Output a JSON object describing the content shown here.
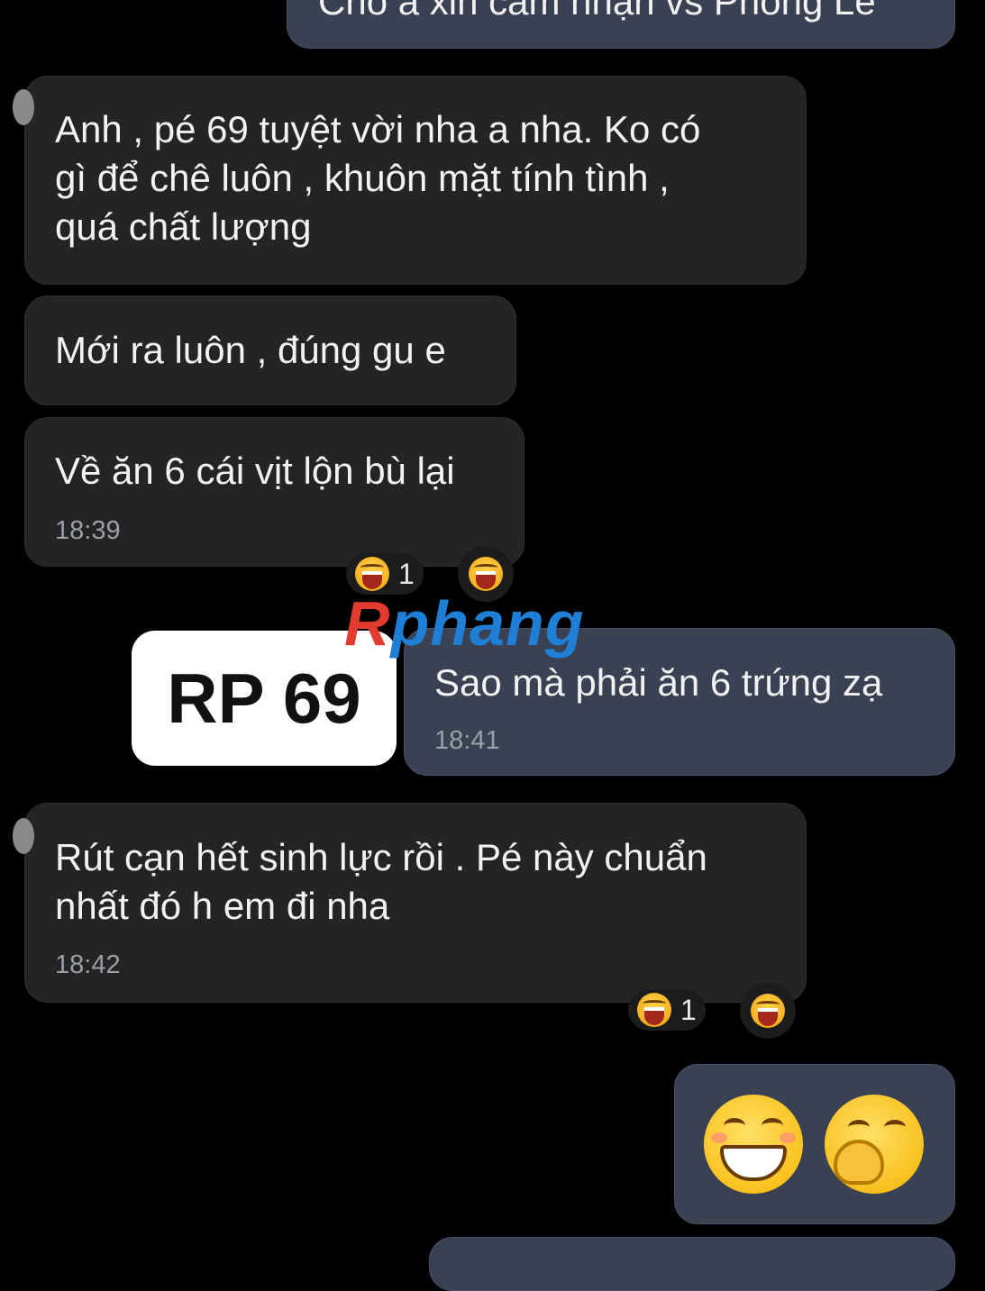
{
  "messages": {
    "top_partial": {
      "text": "Cho a xin cảm nhận vs Phong Lê"
    },
    "m1": {
      "text": "Anh , pé 69 tuyệt vời nha a nha. Ko có\ngì để chê luôn , khuôn mặt tính tình ,\nquá chất lượng"
    },
    "m2": {
      "text": "Mới ra luôn , đúng gu e"
    },
    "m3": {
      "text": "Về ăn 6 cái vịt lộn bù lại",
      "time": "18:39",
      "reaction_count": "1"
    },
    "m4": {
      "text": "Sao mà phải ăn 6 trứng zạ",
      "time": "18:41"
    },
    "m5": {
      "text": "Rút cạn hết sinh lực rồi . Pé này chuẩn\nnhất đó h em đi nha",
      "time": "18:42",
      "reaction_count": "1"
    }
  },
  "overlay": {
    "label": "RP 69",
    "watermark_r": "R",
    "watermark_rest": "phang"
  },
  "icons": {
    "reaction": "laughing-face-icon",
    "emoji1": "grinning-face-icon",
    "emoji2": "giggling-face-icon"
  },
  "colors": {
    "background": "#000000",
    "incoming_bubble": "#242424",
    "outgoing_bubble": "#3a4152",
    "watermark_red": "#e23a2e",
    "watermark_blue": "#1f7fd6"
  }
}
